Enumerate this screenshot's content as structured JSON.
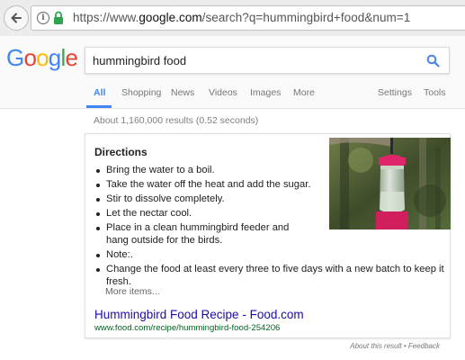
{
  "browser": {
    "url_prefix": "https://www.",
    "url_domain": "google.com",
    "url_rest": "/search?q=hummingbird+food&num=1"
  },
  "logo": {
    "letters": [
      "G",
      "o",
      "o",
      "g",
      "l",
      "e"
    ]
  },
  "search": {
    "query": "hummingbird food"
  },
  "tabs": {
    "all": "All",
    "shopping": "Shopping",
    "news": "News",
    "videos": "Videos",
    "images": "Images",
    "more": "More",
    "settings": "Settings",
    "tools": "Tools"
  },
  "stats": "About 1,160,000 results (0.52 seconds)",
  "snippet": {
    "heading": "Directions",
    "steps": [
      "Bring the water to a boil.",
      "Take the water off the heat and add the sugar.",
      "Stir to dissolve completely.",
      "Let the nectar cool.",
      "Place in a clean hummingbird feeder and hang outside for the birds.",
      "Note:.",
      "Change the food at least every three to five days with a new batch to keep it fresh."
    ],
    "more_items": "More items...",
    "result_title": "Hummingbird Food Recipe - Food.com",
    "result_url": "www.food.com/recipe/hummingbird-food-254206"
  },
  "footer": {
    "about": "About this result",
    "separator": " • ",
    "feedback": "Feedback"
  },
  "colors": {
    "accent": "#4285f4",
    "link": "#1a0dab",
    "url_green": "#006621",
    "lock_green": "#2ea44f",
    "logo": [
      "#4285f4",
      "#ea4335",
      "#fbbc05",
      "#4285f4",
      "#34a853",
      "#ea4335"
    ]
  }
}
